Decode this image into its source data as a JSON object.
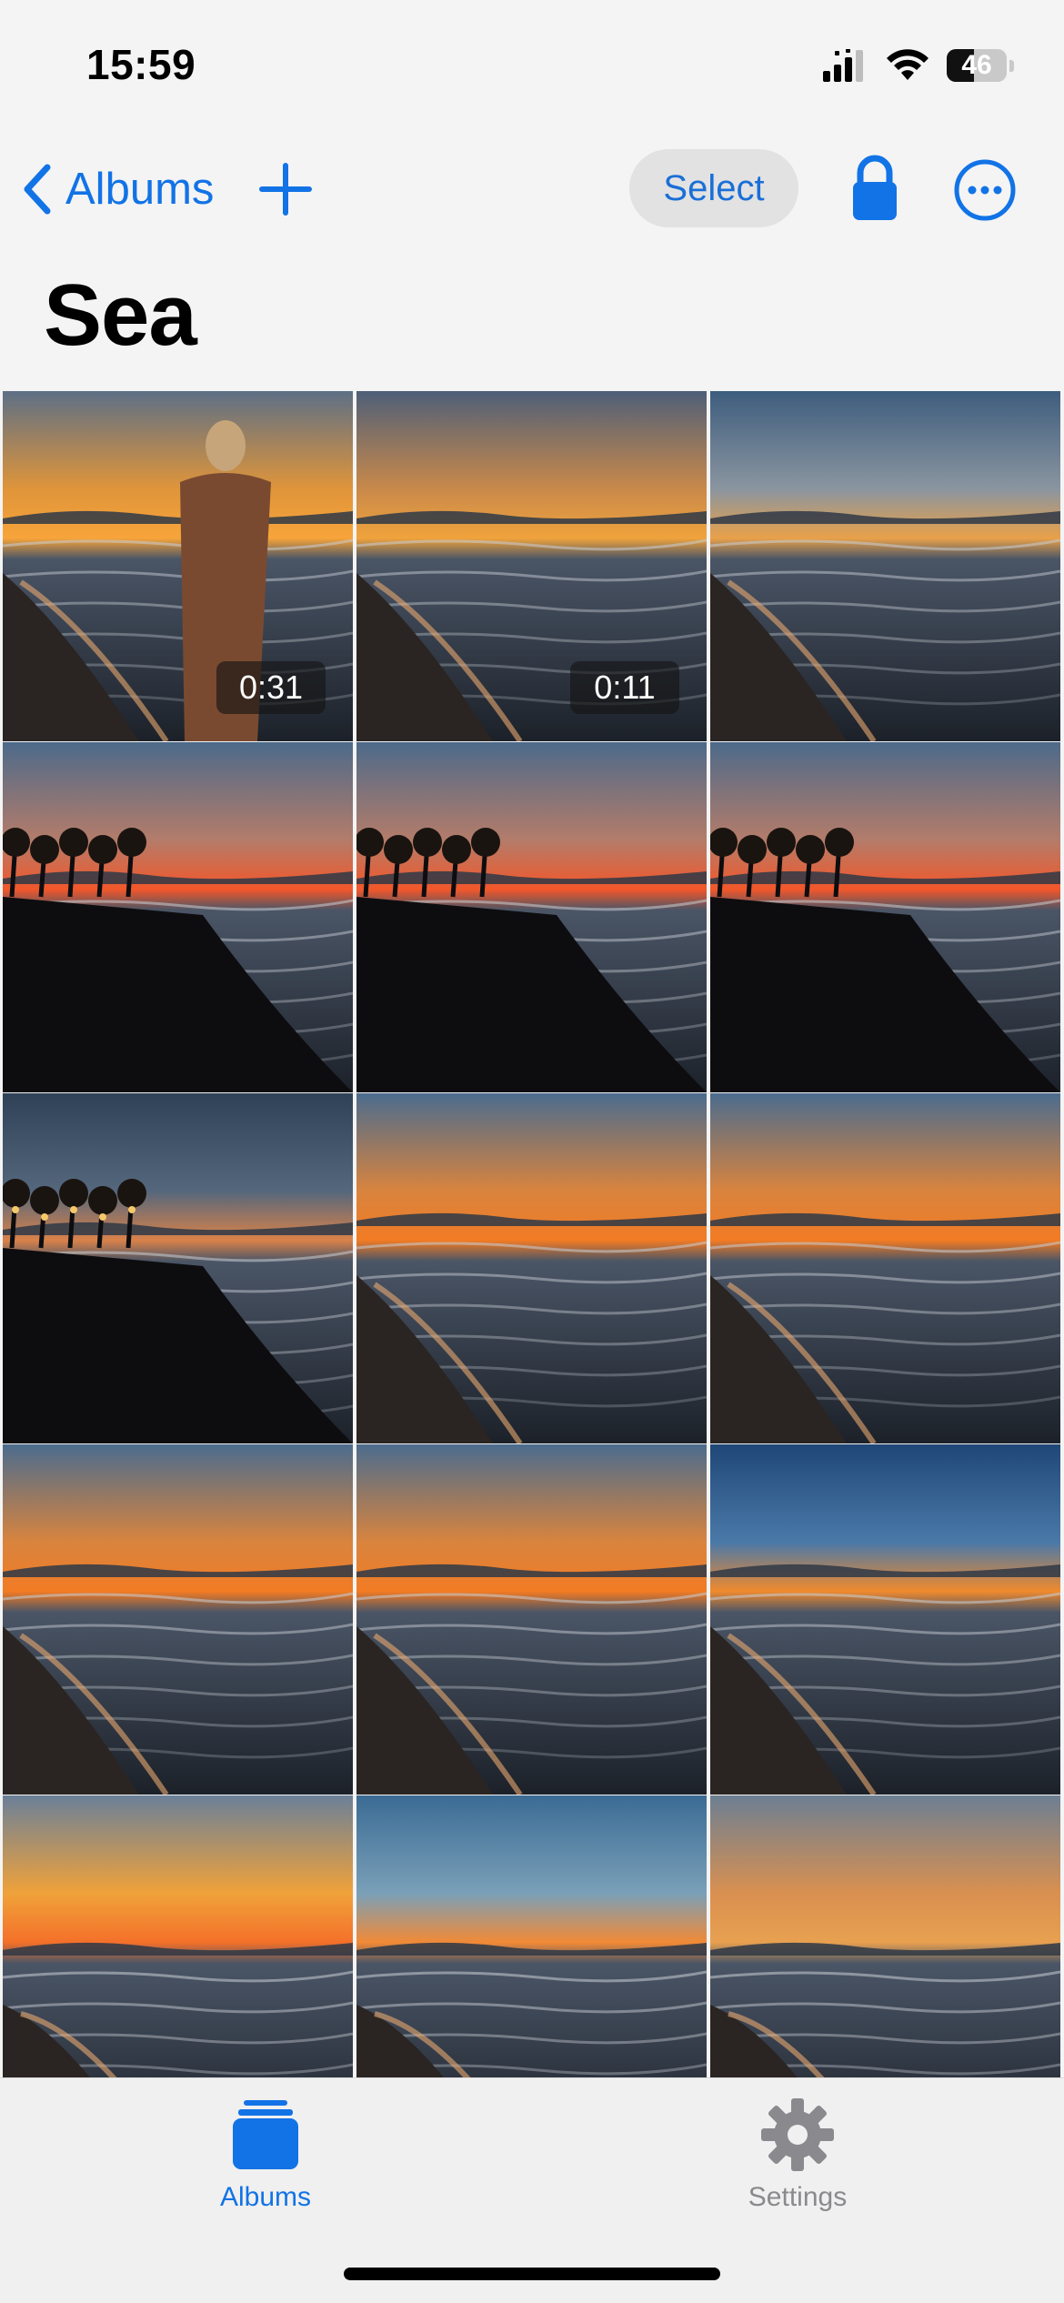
{
  "status_bar": {
    "time": "15:59",
    "battery": "46",
    "battery_level": 0.46
  },
  "nav": {
    "back_label": "Albums",
    "select_label": "Select"
  },
  "album": {
    "title": "Sea"
  },
  "photos": [
    {
      "duration": "0:31",
      "scene": "woman-walking-beach-sunset"
    },
    {
      "duration": "0:11",
      "scene": "waves-beach-headland-sunset"
    },
    {
      "duration": "",
      "scene": "surf-beach-headland"
    },
    {
      "duration": "",
      "scene": "palm-silhouette-beach-sunset"
    },
    {
      "duration": "",
      "scene": "palm-silhouette-beach-sunset"
    },
    {
      "duration": "",
      "scene": "palm-silhouette-beach-sunset"
    },
    {
      "duration": "",
      "scene": "lit-resort-beach-dusk"
    },
    {
      "duration": "",
      "scene": "wet-sand-sea-sunset"
    },
    {
      "duration": "",
      "scene": "wet-sand-sea-sunset"
    },
    {
      "duration": "",
      "scene": "wet-sand-sea-sunset"
    },
    {
      "duration": "",
      "scene": "wet-sand-sea-sunset"
    },
    {
      "duration": "",
      "scene": "wet-sand-sea-dusk"
    },
    {
      "duration": "",
      "scene": "open-sea-sunset"
    },
    {
      "duration": "",
      "scene": "open-sea-headland-sunset"
    },
    {
      "duration": "",
      "scene": "shoreline-sunset"
    }
  ],
  "tabs": [
    {
      "label": "Albums",
      "icon": "albums-icon",
      "active": true
    },
    {
      "label": "Settings",
      "icon": "gear-icon",
      "active": false
    }
  ],
  "colors": {
    "accent": "#1273e6",
    "inactive": "#8a8a8e",
    "background": "#f4f4f4"
  }
}
